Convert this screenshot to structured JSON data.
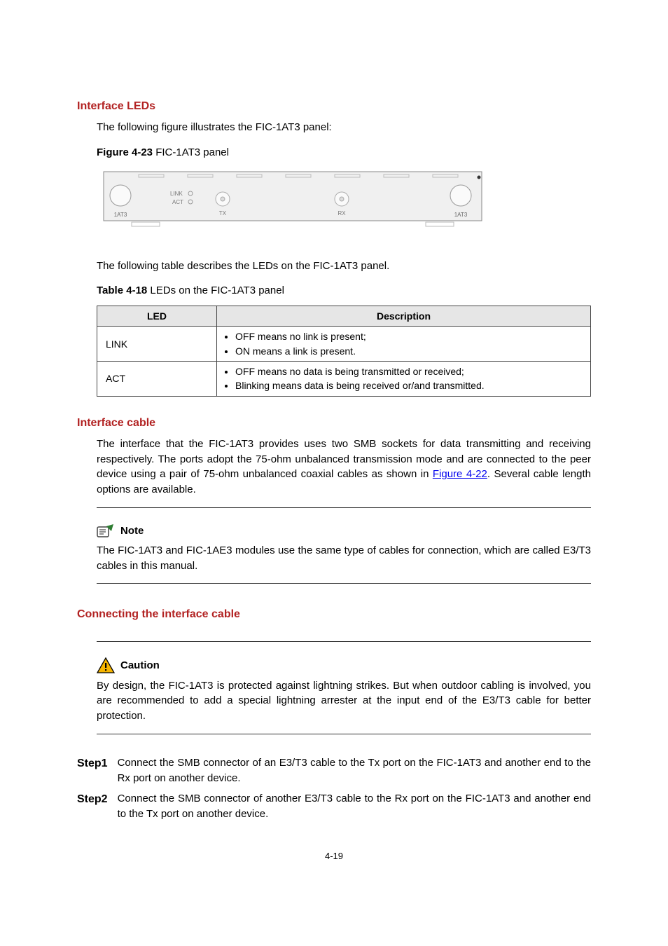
{
  "sections": {
    "leds_heading": "Interface LEDs",
    "leds_intro": "The following figure illustrates the FIC-1AT3 panel:",
    "fig23_bold": "Figure 4-23",
    "fig23_rest": " FIC-1AT3 panel",
    "panel": {
      "label_left": "1AT3",
      "link": "LINK",
      "act": "ACT",
      "tx": "TX",
      "rx": "RX",
      "label_right": "1AT3"
    },
    "leds_table_intro": "The following table describes the LEDs on the FIC-1AT3 panel.",
    "tbl_caption_bold": "Table 4-18",
    "tbl_caption_rest": " LEDs on the FIC-1AT3 panel",
    "tbl_head_led": "LED",
    "tbl_head_desc": "Description",
    "tbl_rows": [
      {
        "led": "LINK",
        "items": [
          "OFF means no link is present;",
          "ON means a link is present."
        ]
      },
      {
        "led": "ACT",
        "items": [
          "OFF means no data is being transmitted or received;",
          "Blinking means data is being received or/and transmitted."
        ]
      }
    ],
    "cable_heading": "Interface cable",
    "cable_para_before_link": "The interface that the FIC-1AT3 provides uses two SMB sockets for data transmitting and receiving respectively. The ports adopt the 75-ohm unbalanced transmission mode and are connected to the peer device using a pair of 75-ohm unbalanced coaxial cables as shown in ",
    "cable_link_text": "Figure 4-22",
    "cable_para_after_link": ". Several cable length options are available.",
    "note_label": "Note",
    "note_body": "The FIC-1AT3 and FIC-1AE3 modules use the same type of cables for connection, which are called E3/T3 cables in this manual.",
    "connect_heading": "Connecting the interface cable",
    "caution_label": "Caution",
    "caution_body": "By design, the FIC-1AT3 is protected against lightning strikes. But when outdoor cabling is involved, you are recommended to add a special lightning arrester at the input end of the E3/T3 cable for better protection.",
    "steps": [
      {
        "label": "Step1",
        "body": "Connect the SMB connector of an E3/T3 cable to the Tx port on the FIC-1AT3 and another end to the Rx port on another device."
      },
      {
        "label": "Step2",
        "body": "Connect the SMB connector of another E3/T3 cable to the Rx port on the FIC-1AT3 and another end to the Tx port on another device."
      }
    ],
    "footer": "4-19"
  }
}
